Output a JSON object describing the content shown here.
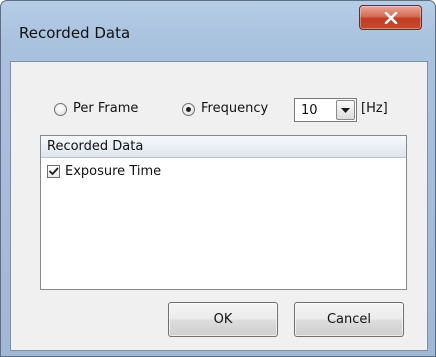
{
  "window": {
    "title": "Recorded Data",
    "close_icon": "close-icon"
  },
  "mode": {
    "options": [
      {
        "label": "Per Frame",
        "checked": false
      },
      {
        "label": "Frequency",
        "checked": true
      }
    ],
    "frequency_value": "10",
    "frequency_unit": "[Hz]"
  },
  "list": {
    "header": "Recorded Data",
    "items": [
      {
        "label": "Exposure Time",
        "checked": true
      }
    ]
  },
  "buttons": {
    "ok_label": "OK",
    "cancel_label": "Cancel"
  }
}
